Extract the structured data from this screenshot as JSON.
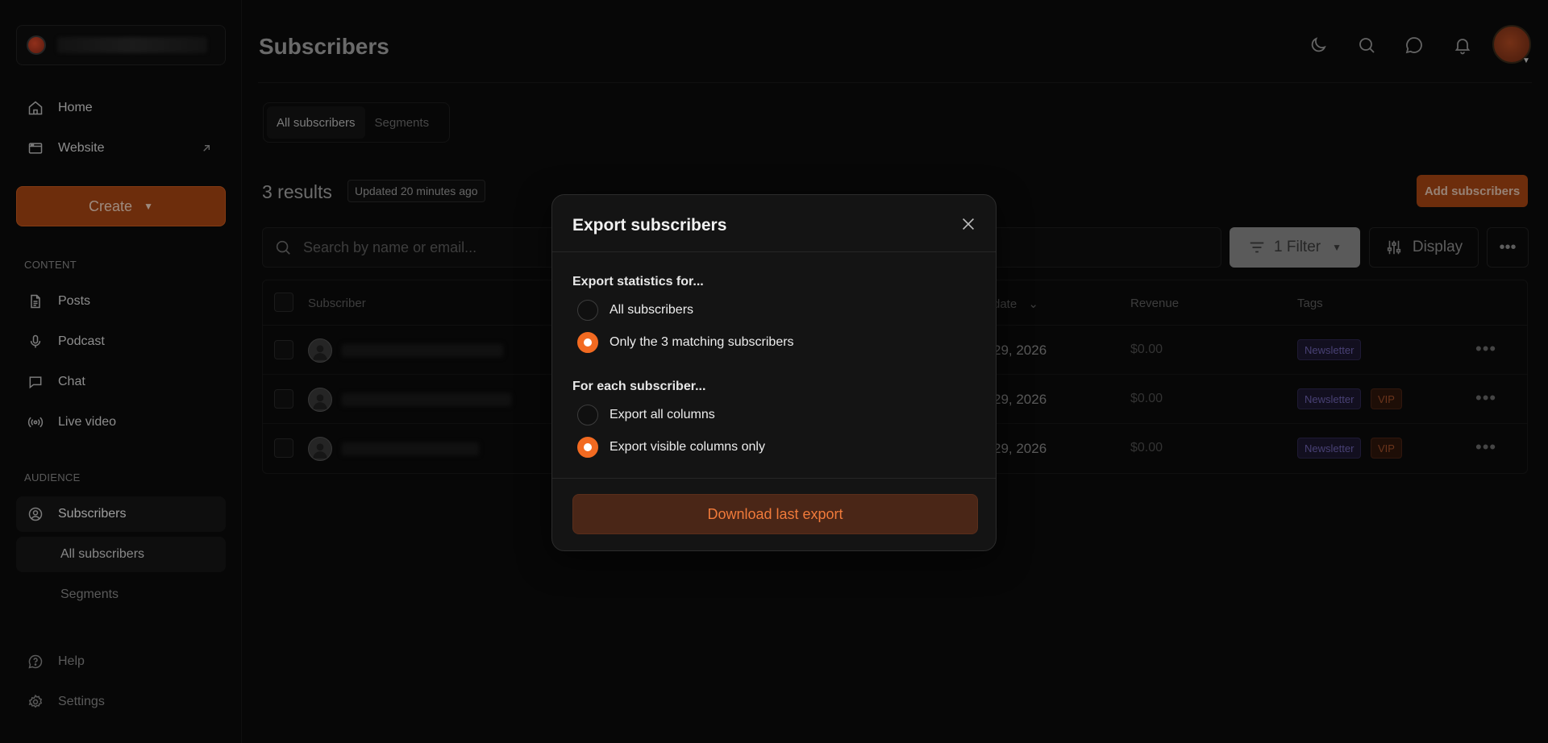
{
  "sidebar": {
    "home_label": "Home",
    "website_label": "Website",
    "create_label": "Create",
    "content_section": "CONTENT",
    "posts_label": "Posts",
    "podcast_label": "Podcast",
    "chat_label": "Chat",
    "live_video_label": "Live video",
    "audience_section": "AUDIENCE",
    "subscribers_label": "Subscribers",
    "all_subscribers_label": "All subscribers",
    "segments_label": "Segments",
    "help_label": "Help",
    "settings_label": "Settings"
  },
  "header": {
    "title": "Subscribers"
  },
  "tabs": {
    "all_label": "All subscribers",
    "segments_label": "Segments"
  },
  "results": {
    "count_label": "3 results",
    "updated_label": "Updated 20 minutes ago",
    "add_button": "Add subscribers"
  },
  "search": {
    "placeholder": "Search by name or email..."
  },
  "toolbar": {
    "filter_label": "1 Filter",
    "display_label": "Display"
  },
  "table": {
    "headers": {
      "subscriber": "Subscriber",
      "date": "date",
      "revenue": "Revenue",
      "tags": "Tags"
    },
    "rows": [
      {
        "date": "29, 2026",
        "revenue": "$0.00",
        "tags": [
          "Newsletter"
        ]
      },
      {
        "date": "29, 2026",
        "revenue": "$0.00",
        "tags": [
          "Newsletter",
          "VIP"
        ]
      },
      {
        "date": "29, 2026",
        "revenue": "$0.00",
        "tags": [
          "Newsletter",
          "VIP"
        ]
      }
    ]
  },
  "modal": {
    "title": "Export subscribers",
    "stats_label": "Export statistics for...",
    "stats_options": [
      "All subscribers",
      "Only the 3 matching subscribers"
    ],
    "stats_selected": 1,
    "columns_label": "For each subscriber...",
    "columns_options": [
      "Export all columns",
      "Export visible columns only"
    ],
    "columns_selected": 1,
    "download_label": "Download last export"
  },
  "colors": {
    "accent": "#f26a21",
    "create_button": "#a84613",
    "newsletter_tag": "#6f63b2",
    "vip_tag": "#a4512a"
  }
}
